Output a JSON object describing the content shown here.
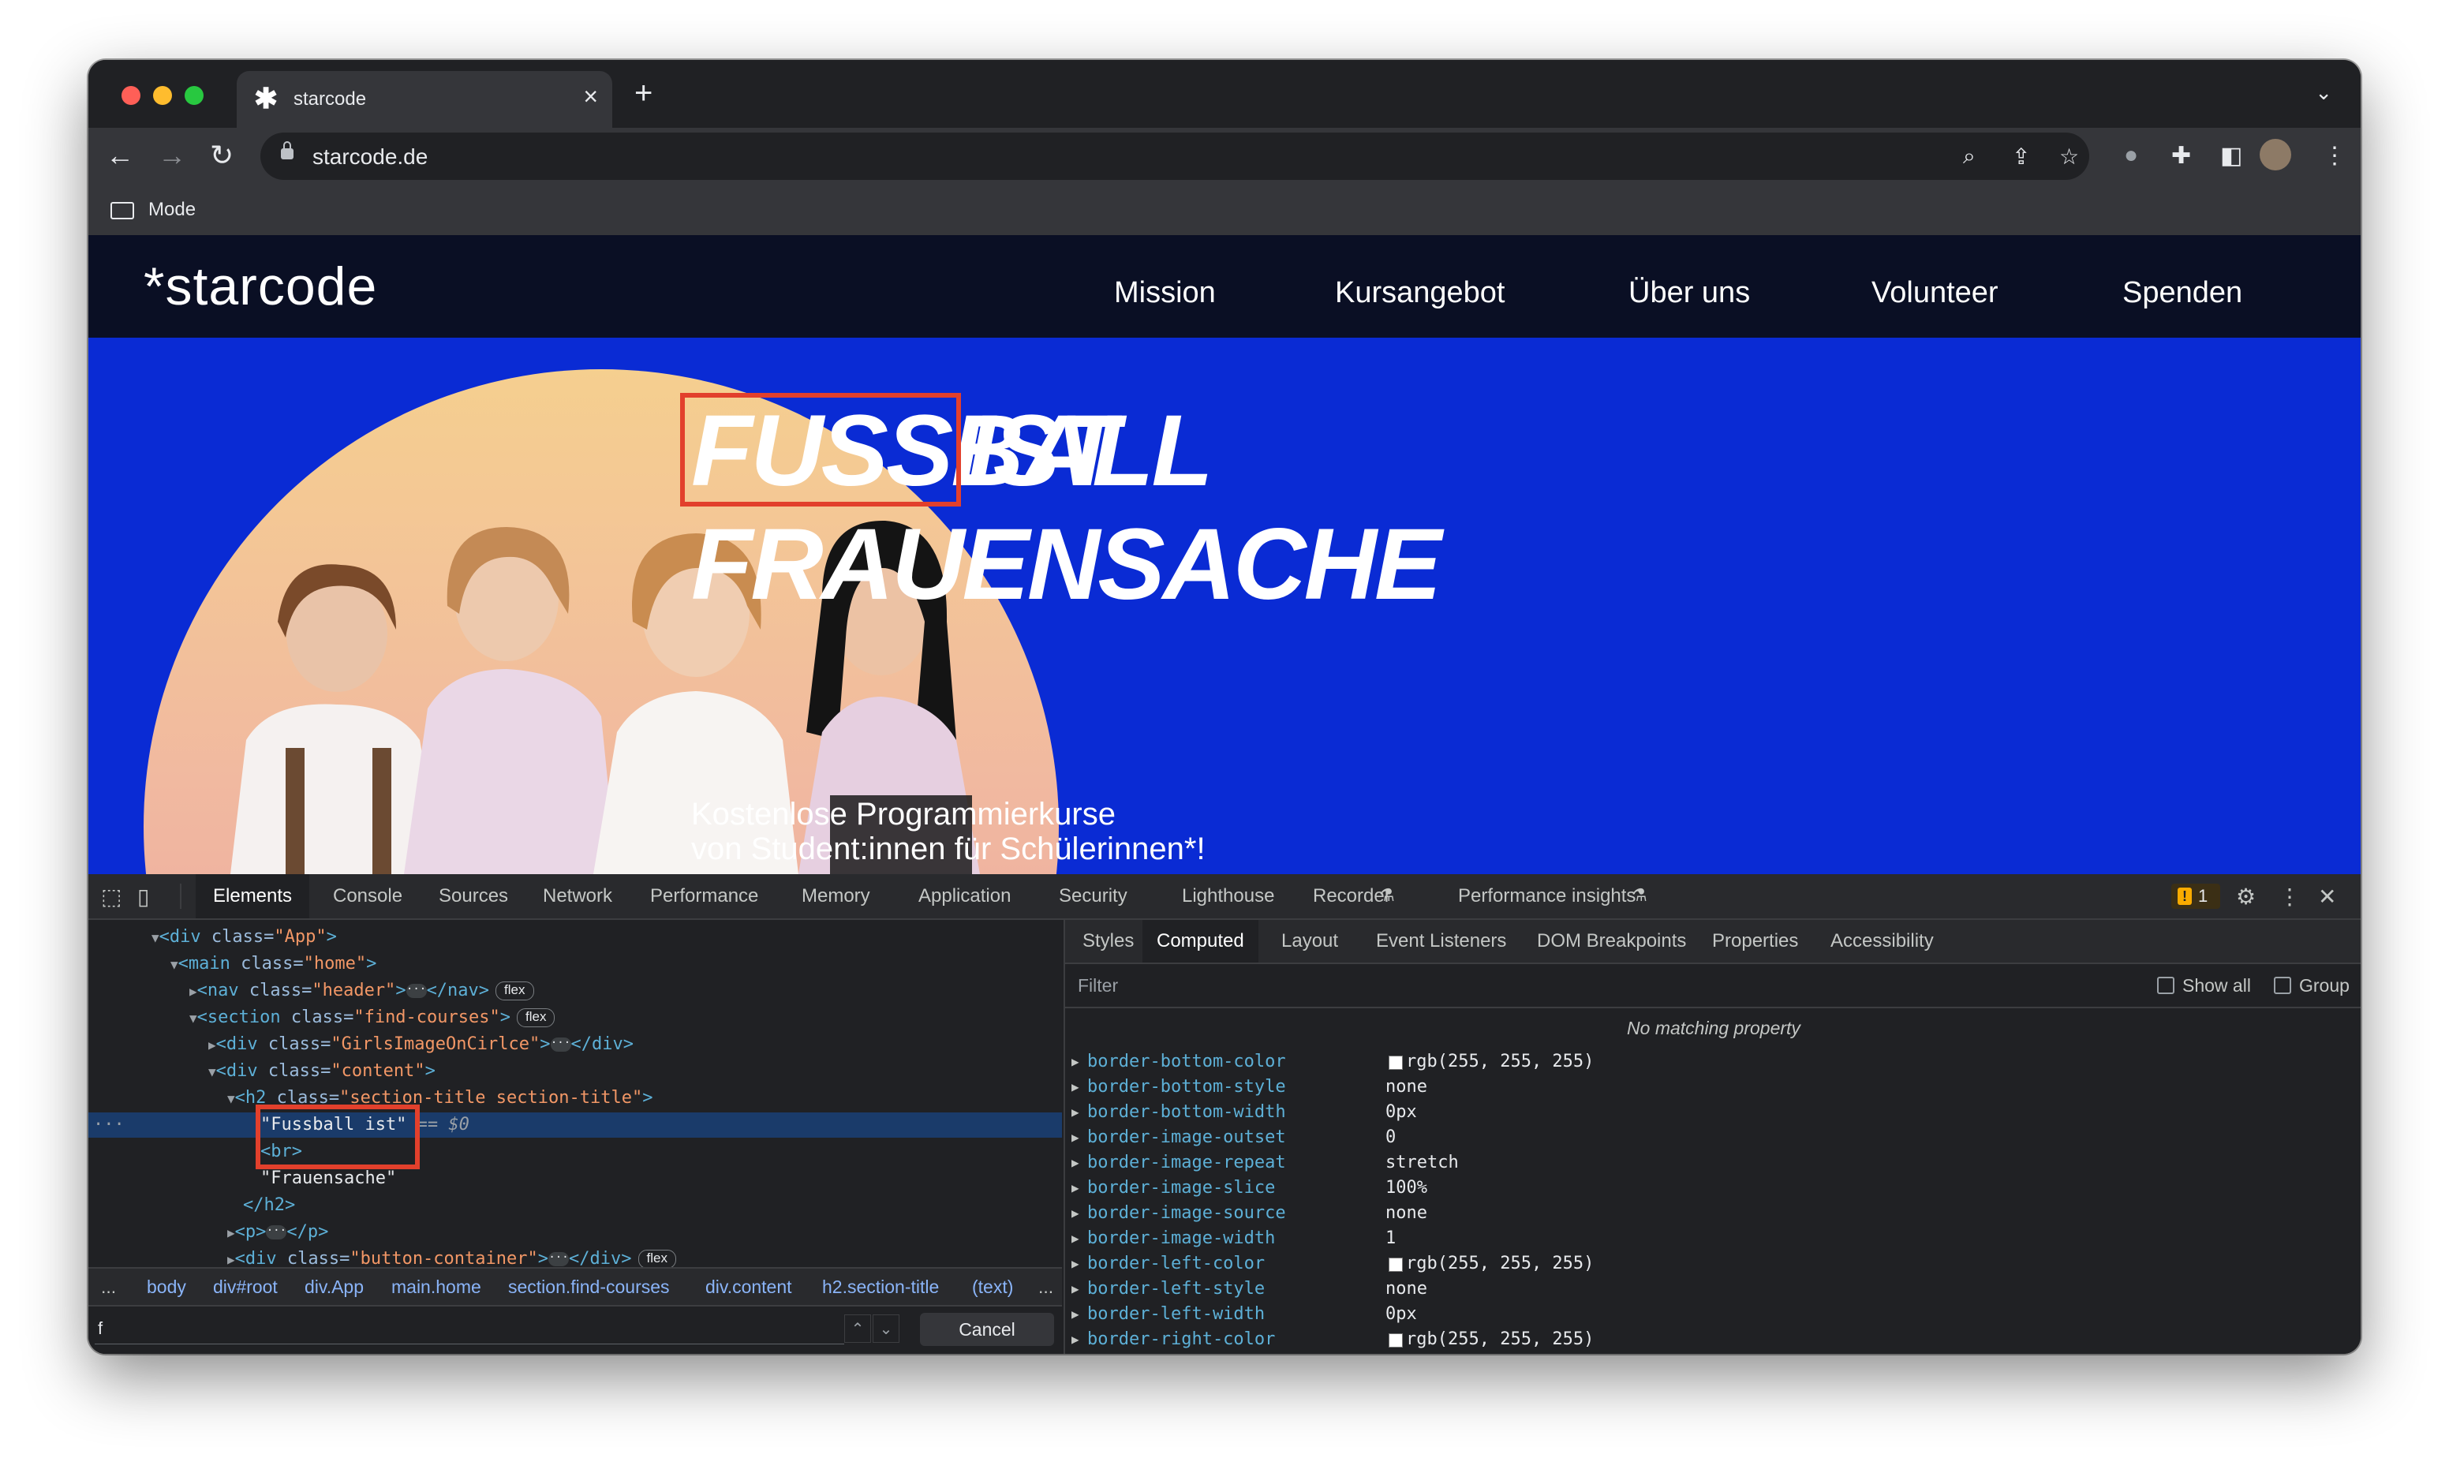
{
  "browser": {
    "tab_title": "starcode",
    "tab_favicon": "asterisk-icon",
    "url": "starcode.de",
    "bookmarks": [
      {
        "label": "Mode",
        "icon": "folder-icon"
      }
    ],
    "traffic_lights": {
      "close": "#ff5f57",
      "minimize": "#febc2e",
      "maximize": "#28c840"
    }
  },
  "site": {
    "logo": "*starcode",
    "nav": [
      "Mission",
      "Kursangebot",
      "Über uns",
      "Volunteer",
      "Spenden"
    ],
    "headline_line1_word1": "FUSSBALL",
    "headline_line1_word2": "IST",
    "headline_line2": "FRAUENSACHE",
    "subtitle_line1": "Kostenlose Programmierkurse",
    "subtitle_line2": "von Student:innen für Schülerinnen*!",
    "colors": {
      "header_bg": "#0a0f24",
      "hero_bg": "#0a2bd4",
      "highlight_box": "#e2402c"
    }
  },
  "devtools": {
    "tabs": [
      "Elements",
      "Console",
      "Sources",
      "Network",
      "Performance",
      "Memory",
      "Application",
      "Security",
      "Lighthouse",
      "Recorder",
      "Performance insights"
    ],
    "active_tab": "Elements",
    "issues_count": "1",
    "dom": {
      "l1": {
        "tag": "<div",
        "attr": " class=",
        "val": "\"App\"",
        "end": ">"
      },
      "l2": {
        "tag": "<main",
        "attr": " class=",
        "val": "\"home\"",
        "end": ">"
      },
      "l3": {
        "tag": "<nav",
        "attr": " class=",
        "val": "\"header\"",
        "end": ">",
        "close": "</nav>",
        "badge": "flex"
      },
      "l4": {
        "tag": "<section",
        "attr": " class=",
        "val": "\"find-courses\"",
        "end": ">",
        "badge": "flex"
      },
      "l5": {
        "tag": "<div",
        "attr": " class=",
        "val": "\"GirlsImageOnCirlce\"",
        "end": ">",
        "close": "</div>"
      },
      "l6": {
        "tag": "<div",
        "attr": " class=",
        "val": "\"content\"",
        "end": ">"
      },
      "l7": {
        "tag": "<h2",
        "attr": " class=",
        "val": "\"section-title section-title\"",
        "end": ">"
      },
      "l8": {
        "text": "\"Fussball ist\"",
        "suffix": " == $0"
      },
      "l9": {
        "tag": "<br>"
      },
      "l10": {
        "text": "\"Frauensache\""
      },
      "l11": {
        "tag": "</h2>"
      },
      "l12": {
        "tag": "<p>",
        "close": "</p>"
      },
      "l13": {
        "tag": "<div",
        "attr": " class=",
        "val": "\"button-container\"",
        "end": ">",
        "close": "</div>",
        "badge": "flex"
      }
    },
    "breadcrumbs": [
      "...",
      "body",
      "div#root",
      "div.App",
      "main.home",
      "section.find-courses",
      "div.content",
      "h2.section-title",
      "(text)",
      "..."
    ],
    "search_value": "f",
    "cancel_label": "Cancel",
    "side_tabs": [
      "Styles",
      "Computed",
      "Layout",
      "Event Listeners",
      "DOM Breakpoints",
      "Properties",
      "Accessibility"
    ],
    "active_side_tab": "Computed",
    "filter_placeholder": "Filter",
    "show_all_label": "Show all",
    "group_label": "Group",
    "no_match": "No matching property",
    "properties": [
      {
        "name": "border-bottom-color",
        "value": "rgb(255, 255, 255)",
        "swatch": true
      },
      {
        "name": "border-bottom-style",
        "value": "none"
      },
      {
        "name": "border-bottom-width",
        "value": "0px"
      },
      {
        "name": "border-image-outset",
        "value": "0"
      },
      {
        "name": "border-image-repeat",
        "value": "stretch"
      },
      {
        "name": "border-image-slice",
        "value": "100%"
      },
      {
        "name": "border-image-source",
        "value": "none"
      },
      {
        "name": "border-image-width",
        "value": "1"
      },
      {
        "name": "border-left-color",
        "value": "rgb(255, 255, 255)",
        "swatch": true
      },
      {
        "name": "border-left-style",
        "value": "none"
      },
      {
        "name": "border-left-width",
        "value": "0px"
      },
      {
        "name": "border-right-color",
        "value": "rgb(255, 255, 255)",
        "swatch": true
      }
    ]
  }
}
